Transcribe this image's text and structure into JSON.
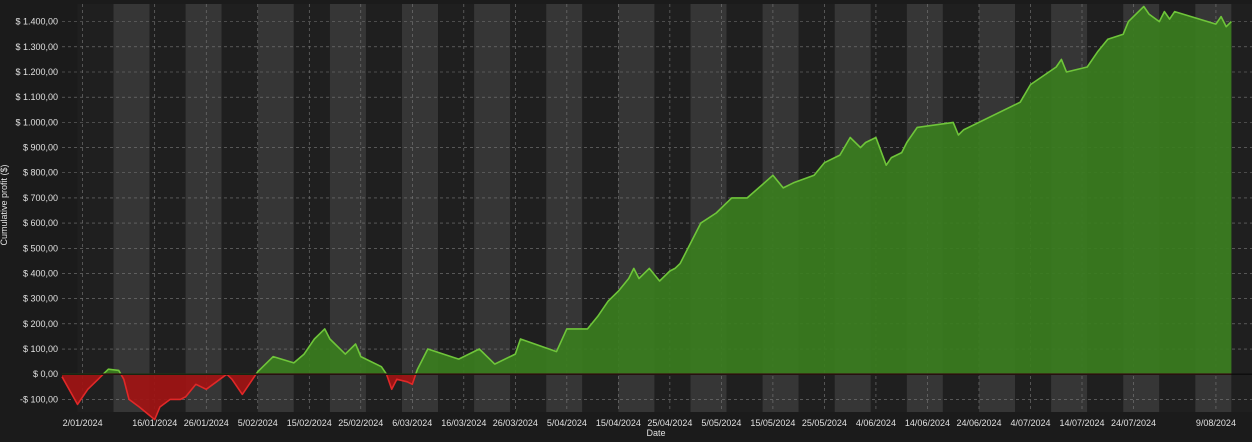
{
  "chart_data": {
    "type": "area",
    "title": "",
    "xlabel": "Date",
    "ylabel": "Cumulative profit ($)",
    "ylim": [
      -150,
      1470
    ],
    "yticks": [
      -100,
      0,
      100,
      200,
      300,
      400,
      500,
      600,
      700,
      800,
      900,
      1000,
      1100,
      1200,
      1300,
      1400
    ],
    "ytick_labels": [
      "-$ 100,00",
      "$ 0,00",
      "$ 100,00",
      "$ 200,00",
      "$ 300,00",
      "$ 400,00",
      "$ 500,00",
      "$ 600,00",
      "$ 700,00",
      "$ 800,00",
      "$ 900,00",
      "$ 1.000,00",
      "$ 1.100,00",
      "$ 1.200,00",
      "$ 1.300,00",
      "$ 1.400,00"
    ],
    "xlim": [
      "2023-12-29",
      "2024-08-16"
    ],
    "xticks": [
      "2024-01-02",
      "2024-01-16",
      "2024-01-26",
      "2024-02-05",
      "2024-02-15",
      "2024-02-25",
      "2024-03-06",
      "2024-03-16",
      "2024-03-26",
      "2024-04-05",
      "2024-04-15",
      "2024-04-25",
      "2024-05-05",
      "2024-05-15",
      "2024-05-25",
      "2024-06-04",
      "2024-06-14",
      "2024-06-24",
      "2024-07-04",
      "2024-07-14",
      "2024-07-24",
      "2024-08-09"
    ],
    "xtick_labels": [
      "2/01/2024",
      "16/01/2024",
      "26/01/2024",
      "5/02/2024",
      "15/02/2024",
      "25/02/2024",
      "6/03/2024",
      "16/03/2024",
      "26/03/2024",
      "5/04/2024",
      "15/04/2024",
      "25/04/2024",
      "5/05/2024",
      "15/05/2024",
      "25/05/2024",
      "4/06/2024",
      "14/06/2024",
      "24/06/2024",
      "4/07/2024",
      "14/07/2024",
      "24/07/2024",
      "9/08/2024"
    ],
    "grid": true,
    "x": [
      "2023-12-29",
      "2024-01-01",
      "2024-01-03",
      "2024-01-05",
      "2024-01-07",
      "2024-01-09",
      "2024-01-10",
      "2024-01-11",
      "2024-01-13",
      "2024-01-16",
      "2024-01-17",
      "2024-01-19",
      "2024-01-21",
      "2024-01-22",
      "2024-01-24",
      "2024-01-26",
      "2024-01-28",
      "2024-01-30",
      "2024-01-31",
      "2024-02-02",
      "2024-02-04",
      "2024-02-05",
      "2024-02-08",
      "2024-02-12",
      "2024-02-14",
      "2024-02-16",
      "2024-02-17",
      "2024-02-18",
      "2024-02-19",
      "2024-02-22",
      "2024-02-24",
      "2024-02-25",
      "2024-02-29",
      "2024-03-01",
      "2024-03-02",
      "2024-03-03",
      "2024-03-05",
      "2024-03-06",
      "2024-03-07",
      "2024-03-09",
      "2024-03-15",
      "2024-03-19",
      "2024-03-22",
      "2024-03-26",
      "2024-03-27",
      "2024-04-03",
      "2024-04-05",
      "2024-04-09",
      "2024-04-11",
      "2024-04-13",
      "2024-04-15",
      "2024-04-17",
      "2024-04-18",
      "2024-04-19",
      "2024-04-21",
      "2024-04-23",
      "2024-04-25",
      "2024-04-26",
      "2024-04-27",
      "2024-05-01",
      "2024-05-04",
      "2024-05-07",
      "2024-05-10",
      "2024-05-15",
      "2024-05-17",
      "2024-05-19",
      "2024-05-23",
      "2024-05-25",
      "2024-05-28",
      "2024-05-30",
      "2024-06-01",
      "2024-06-02",
      "2024-06-04",
      "2024-06-06",
      "2024-06-07",
      "2024-06-09",
      "2024-06-10",
      "2024-06-12",
      "2024-06-19",
      "2024-06-20",
      "2024-06-21",
      "2024-07-02",
      "2024-07-04",
      "2024-07-09",
      "2024-07-10",
      "2024-07-11",
      "2024-07-15",
      "2024-07-17",
      "2024-07-19",
      "2024-07-22",
      "2024-07-23",
      "2024-07-26",
      "2024-07-27",
      "2024-07-29",
      "2024-07-30",
      "2024-07-31",
      "2024-08-01",
      "2024-08-09",
      "2024-08-10",
      "2024-08-11",
      "2024-08-12"
    ],
    "series": [
      {
        "values": [
          -10,
          -120,
          -60,
          -20,
          20,
          15,
          -20,
          -100,
          -130,
          -180,
          -130,
          -100,
          -100,
          -90,
          -40,
          -60,
          -30,
          0,
          -20,
          -80,
          -20,
          10,
          70,
          45,
          80,
          140,
          160,
          180,
          140,
          80,
          120,
          70,
          30,
          0,
          -60,
          -20,
          -30,
          -40,
          20,
          100,
          60,
          100,
          40,
          80,
          140,
          90,
          180,
          180,
          230,
          290,
          330,
          380,
          420,
          380,
          420,
          370,
          410,
          420,
          440,
          600,
          640,
          700,
          700,
          790,
          740,
          760,
          790,
          840,
          870,
          940,
          900,
          920,
          940,
          830,
          860,
          880,
          920,
          980,
          1000,
          950,
          970,
          1080,
          1150,
          1220,
          1250,
          1200,
          1220,
          1280,
          1330,
          1350,
          1400,
          1460,
          1430,
          1400,
          1440,
          1410,
          1440,
          1390,
          1420,
          1380,
          1400
        ]
      }
    ],
    "colors": {
      "positive": "#3a7d1e",
      "positive_line": "#6fc53a",
      "negative": "#a11414",
      "negative_line": "#e02828"
    }
  }
}
